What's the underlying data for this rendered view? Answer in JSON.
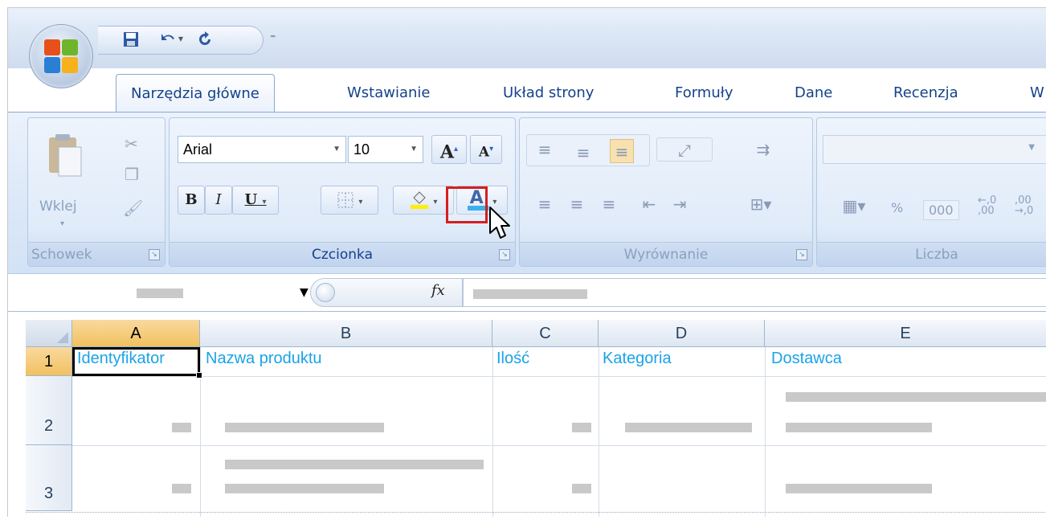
{
  "quick_access": {
    "save_icon": "save-icon",
    "undo_icon": "undo-icon",
    "redo_icon": "redo-icon"
  },
  "tabs": [
    {
      "label": "Narzędzia główne",
      "active": true
    },
    {
      "label": "Wstawianie"
    },
    {
      "label": "Układ strony"
    },
    {
      "label": "Formuły"
    },
    {
      "label": "Dane"
    },
    {
      "label": "Recenzja"
    },
    {
      "label": "W"
    }
  ],
  "ribbon": {
    "clipboard": {
      "paste_label": "Wklej",
      "group_label": "Schowek"
    },
    "font": {
      "font_name": "Arial",
      "font_size": "10",
      "grow_label": "A",
      "shrink_label": "A",
      "bold_label": "B",
      "italic_label": "I",
      "underline_label": "U",
      "font_color_label": "A",
      "group_label": "Czcionka",
      "highlight_color": "#d42020",
      "fill_color": "#ffef00",
      "font_color": "#1aa3e8"
    },
    "alignment": {
      "group_label": "Wyrównanie"
    },
    "number": {
      "group_label": "Liczba",
      "percent_label": "%",
      "thousands_label": "000"
    }
  },
  "formula_bar": {
    "fx_label": "fx"
  },
  "sheet": {
    "columns": [
      "A",
      "B",
      "C",
      "D",
      "E"
    ],
    "rows": [
      "1",
      "2",
      "3"
    ],
    "header_row": [
      "Identyfikator",
      "Nazwa produktu",
      "Ilość",
      "Kategoria",
      "Dostawca"
    ],
    "cell_text_color": "#1aa3e8",
    "selection_color": "#f1c15f"
  }
}
